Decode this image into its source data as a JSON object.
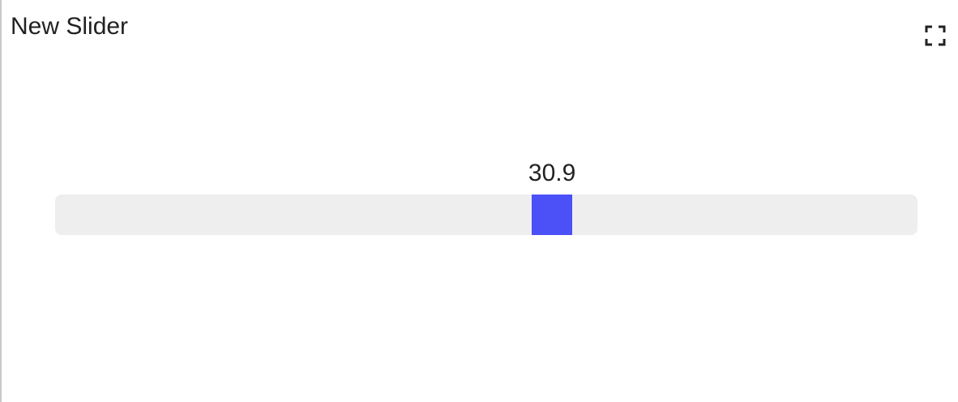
{
  "widget": {
    "title": "New Slider",
    "fullscreen_icon": "fullscreen-icon"
  },
  "slider": {
    "value_label": "30.9",
    "position_fraction": 0.58,
    "thumb_color": "#4b50f7",
    "track_color": "#eeeeee"
  }
}
